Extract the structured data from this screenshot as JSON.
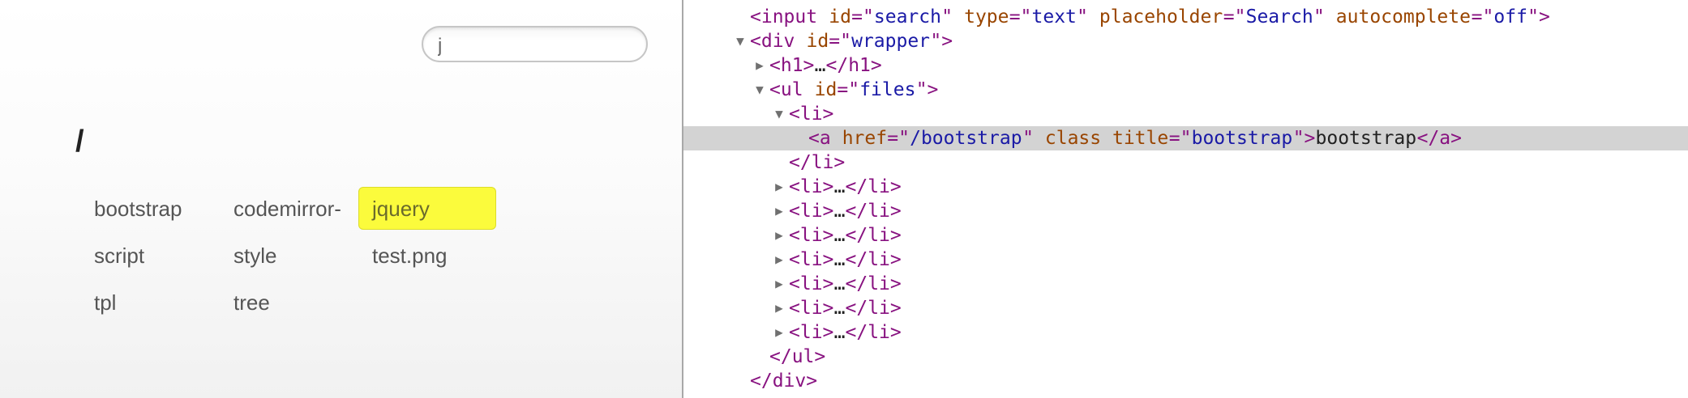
{
  "preview": {
    "search_value": "j",
    "path_title": "/",
    "files": [
      {
        "name": "bootstrap",
        "highlighted": false
      },
      {
        "name": "codemirror-",
        "highlighted": false
      },
      {
        "name": "jquery",
        "highlighted": true
      },
      {
        "name": "script",
        "highlighted": false
      },
      {
        "name": "style",
        "highlighted": false
      },
      {
        "name": "test.png",
        "highlighted": false
      },
      {
        "name": "tpl",
        "highlighted": false
      },
      {
        "name": "tree",
        "highlighted": false
      }
    ]
  },
  "devtools": {
    "top_partial": "▸ / ▸  ▸  /",
    "lines": [
      {
        "tri": "",
        "tokens": [
          [
            "tag",
            "<input "
          ],
          [
            "attr",
            "id"
          ],
          [
            "tag",
            "=\""
          ],
          [
            "val",
            "search"
          ],
          [
            "tag",
            "\" "
          ],
          [
            "attr",
            "type"
          ],
          [
            "tag",
            "=\""
          ],
          [
            "val",
            "text"
          ],
          [
            "tag",
            "\" "
          ],
          [
            "attr",
            "placeholder"
          ],
          [
            "tag",
            "=\""
          ],
          [
            "val",
            "Search"
          ],
          [
            "tag",
            "\" "
          ],
          [
            "attr",
            "autocomplete"
          ],
          [
            "tag",
            "=\""
          ],
          [
            "val",
            "off"
          ],
          [
            "tag",
            "\">"
          ]
        ]
      },
      {
        "tri": "▼",
        "tokens": [
          [
            "tag",
            "<div "
          ],
          [
            "attr",
            "id"
          ],
          [
            "tag",
            "=\""
          ],
          [
            "val",
            "wrapper"
          ],
          [
            "tag",
            "\">"
          ]
        ]
      },
      {
        "tri": "▶",
        "tokens": [
          [
            "tag",
            "<h1>"
          ],
          [
            "txt",
            "…"
          ],
          [
            "tag",
            "</h1>"
          ]
        ]
      },
      {
        "tri": "▼",
        "tokens": [
          [
            "tag",
            "<ul "
          ],
          [
            "attr",
            "id"
          ],
          [
            "tag",
            "=\""
          ],
          [
            "val",
            "files"
          ],
          [
            "tag",
            "\">"
          ]
        ]
      },
      {
        "tri": "▼",
        "tokens": [
          [
            "tag",
            "<li>"
          ]
        ]
      },
      {
        "tri": "",
        "tokens": [
          [
            "tag",
            "<a "
          ],
          [
            "attr",
            "href"
          ],
          [
            "tag",
            "=\""
          ],
          [
            "val",
            "/bootstrap"
          ],
          [
            "tag",
            "\" "
          ],
          [
            "attr",
            "class title"
          ],
          [
            "tag",
            "=\""
          ],
          [
            "val",
            "bootstrap"
          ],
          [
            "tag",
            "\">"
          ],
          [
            "txt",
            "bootstrap"
          ],
          [
            "tag",
            "</a>"
          ]
        ]
      },
      {
        "tri": "",
        "tokens": [
          [
            "tag",
            "</li>"
          ]
        ]
      },
      {
        "tri": "▶",
        "tokens": [
          [
            "tag",
            "<li>"
          ],
          [
            "txt",
            "…"
          ],
          [
            "tag",
            "</li>"
          ]
        ]
      },
      {
        "tri": "▶",
        "tokens": [
          [
            "tag",
            "<li>"
          ],
          [
            "txt",
            "…"
          ],
          [
            "tag",
            "</li>"
          ]
        ]
      },
      {
        "tri": "▶",
        "tokens": [
          [
            "tag",
            "<li>"
          ],
          [
            "txt",
            "…"
          ],
          [
            "tag",
            "</li>"
          ]
        ]
      },
      {
        "tri": "▶",
        "tokens": [
          [
            "tag",
            "<li>"
          ],
          [
            "txt",
            "…"
          ],
          [
            "tag",
            "</li>"
          ]
        ]
      },
      {
        "tri": "▶",
        "tokens": [
          [
            "tag",
            "<li>"
          ],
          [
            "txt",
            "…"
          ],
          [
            "tag",
            "</li>"
          ]
        ]
      },
      {
        "tri": "▶",
        "tokens": [
          [
            "tag",
            "<li>"
          ],
          [
            "txt",
            "…"
          ],
          [
            "tag",
            "</li>"
          ]
        ]
      },
      {
        "tri": "▶",
        "tokens": [
          [
            "tag",
            "<li>"
          ],
          [
            "txt",
            "…"
          ],
          [
            "tag",
            "</li>"
          ]
        ]
      },
      {
        "tri": "",
        "tokens": [
          [
            "tag",
            "</ul>"
          ]
        ]
      },
      {
        "tri": "",
        "tokens": [
          [
            "tag",
            "</div>"
          ]
        ]
      }
    ],
    "colors": {
      "tag": "#881280",
      "attr": "#994500",
      "value": "#1a1aa6",
      "text": "#222222",
      "selected_row": "#d3d3d3",
      "highlight": "#fbfb3c"
    }
  }
}
